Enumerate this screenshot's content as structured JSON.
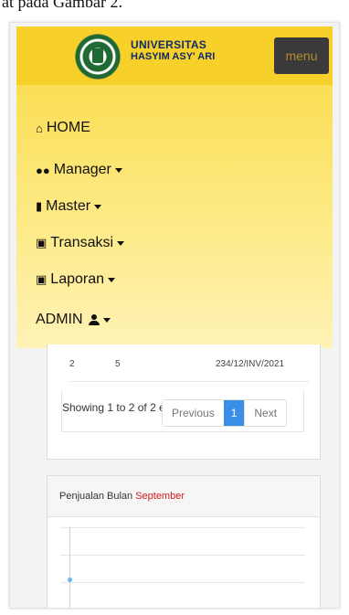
{
  "caption": "at pada Gambar 2.",
  "header": {
    "brand_line1": "UNIVERSITAS",
    "brand_line2": "HASYIM ASY' ARI",
    "menu_label": "menu"
  },
  "nav": {
    "home": "HOME",
    "manager": "Manager",
    "master": "Master",
    "transaksi": "Transaksi",
    "laporan": "Laporan",
    "admin": "ADMIN"
  },
  "table": {
    "row": [
      "2",
      "5",
      "234/12/INV/2021"
    ],
    "info": "Showing 1 to 2 of 2 entries",
    "pagination": {
      "previous": "Previous",
      "current_page": "1",
      "next": "Next"
    }
  },
  "chart_card": {
    "title_prefix": "Penjualan Bulan",
    "month": "September"
  },
  "colors": {
    "navbar_yellow": "#f7d12a",
    "menu_button": "#3a3a3a",
    "pagination_active": "#3a8ee6",
    "month_red": "#d21b1b"
  }
}
